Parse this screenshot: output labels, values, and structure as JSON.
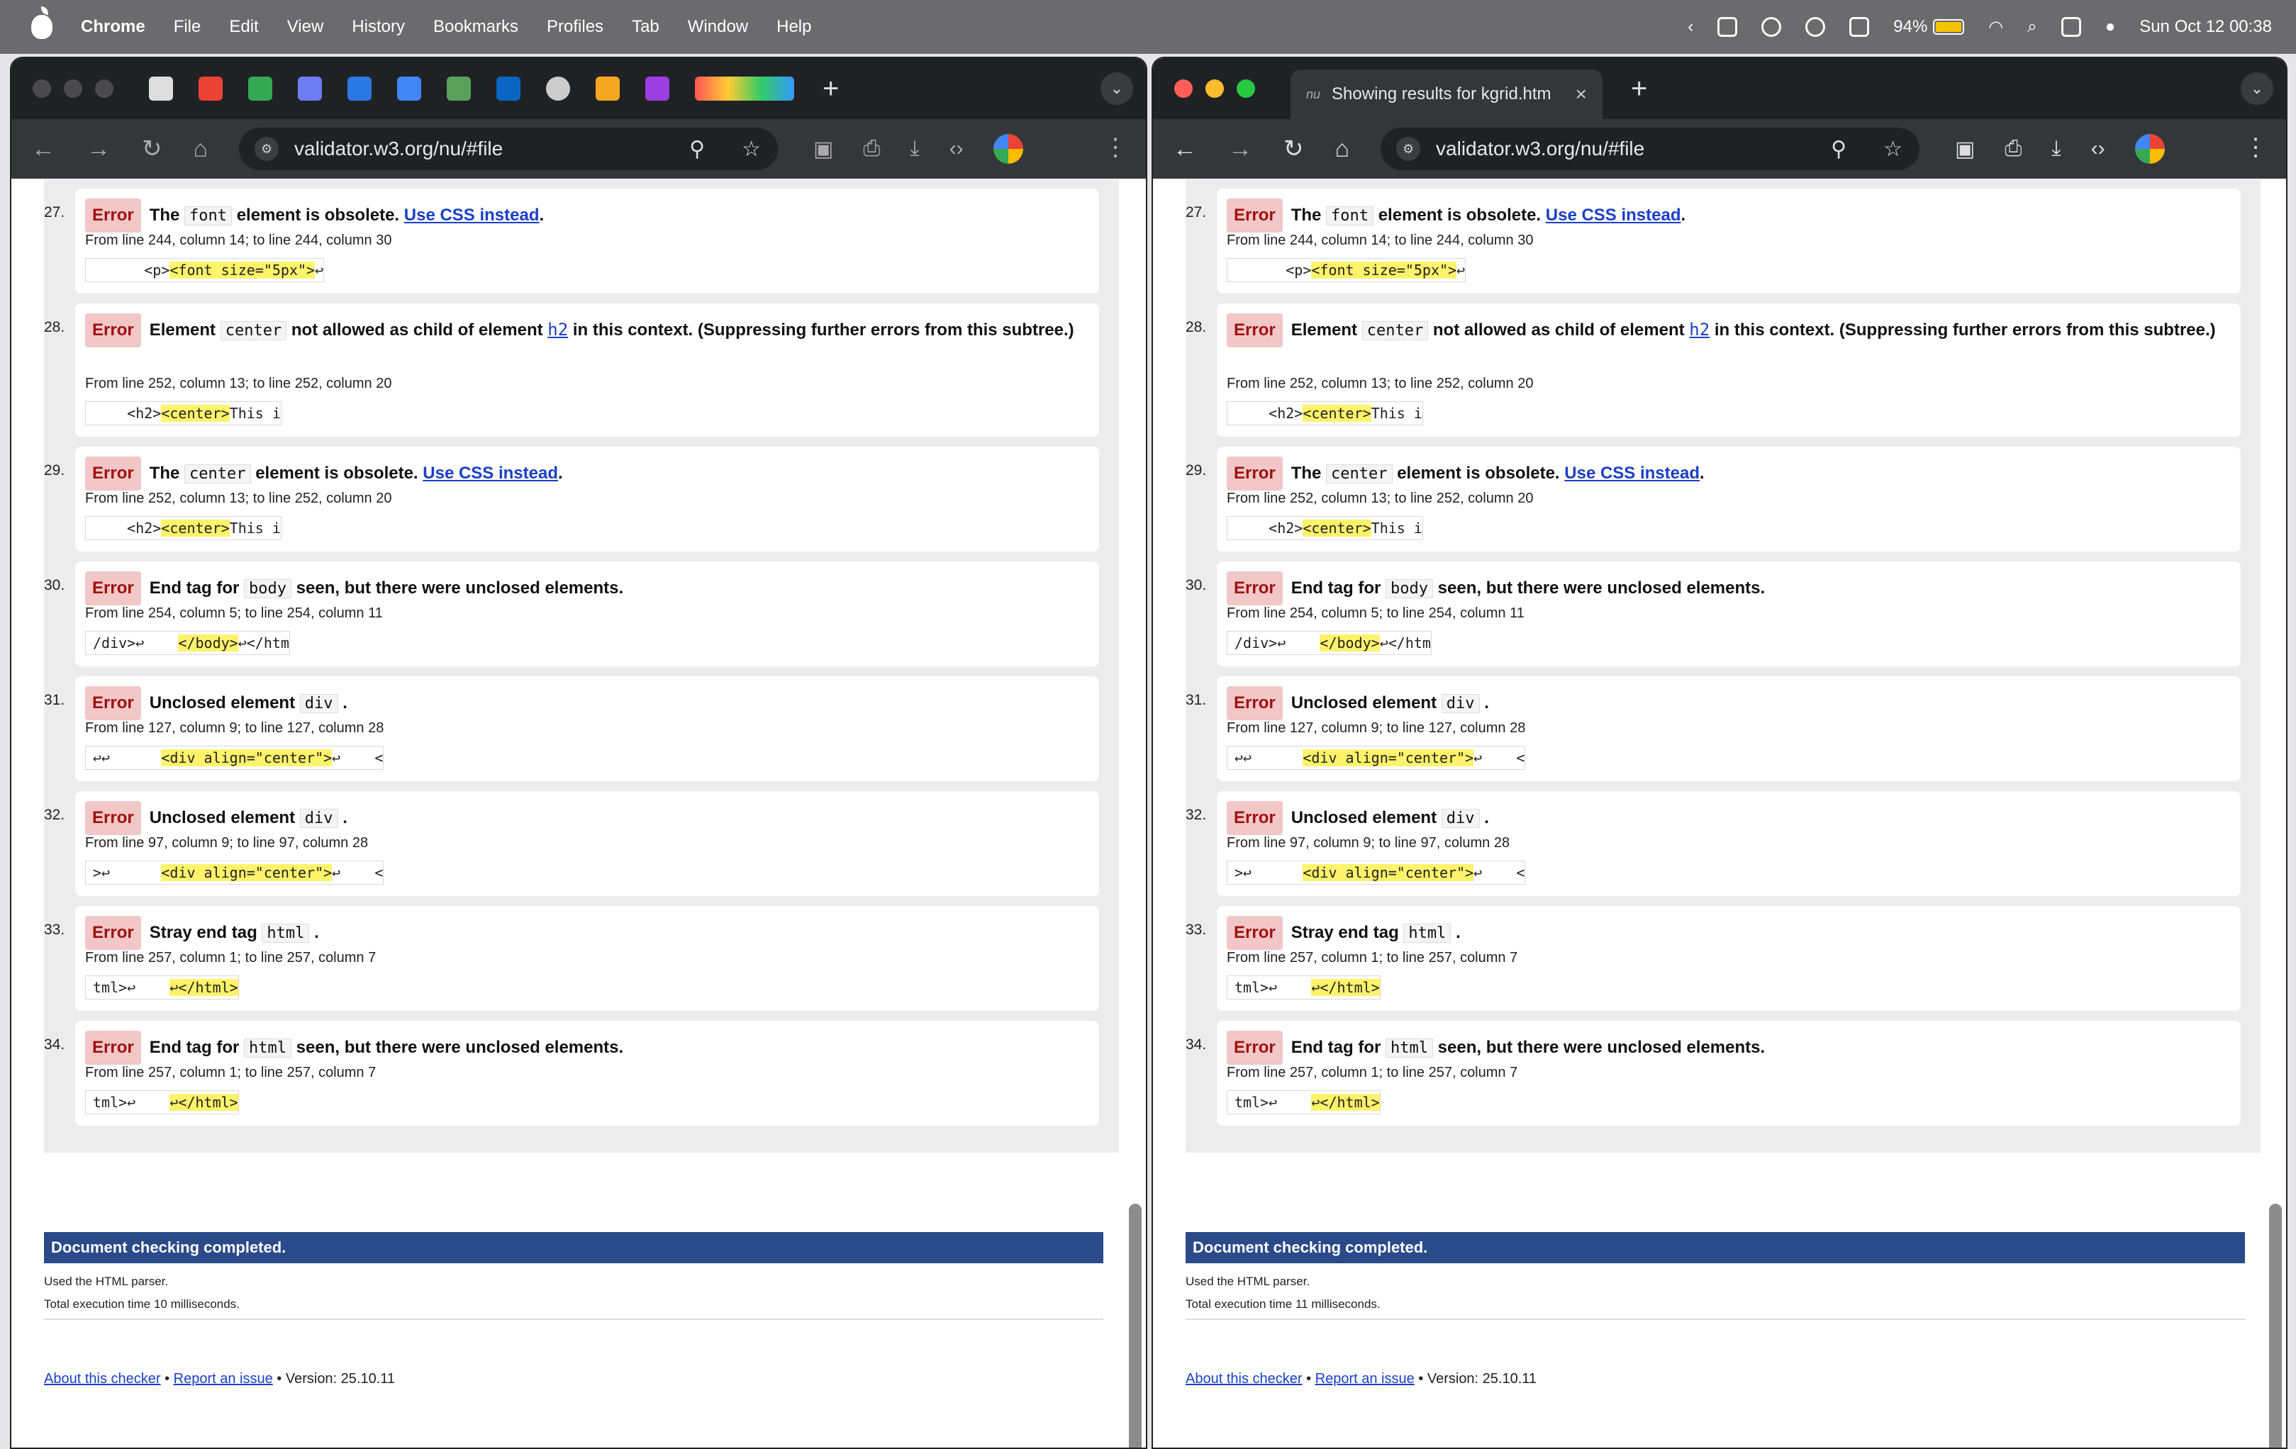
{
  "menubar": {
    "app": "Chrome",
    "items": [
      "File",
      "Edit",
      "View",
      "History",
      "Bookmarks",
      "Profiles",
      "Tab",
      "Window",
      "Help"
    ],
    "battery": "94%",
    "battery_level": 0.94,
    "clock": "Sun Oct 12  00:38"
  },
  "left_window": {
    "url": "validator.w3.org/nu/#file",
    "exec_time": "Total execution time 10 milliseconds."
  },
  "right_window": {
    "tab_title": "Showing results for kgrid.htm",
    "url": "validator.w3.org/nu/#file",
    "exec_time": "Total execution time 11 milliseconds."
  },
  "messages": [
    {
      "n": "27.",
      "badge": "Error",
      "pre": "The",
      "c1": "font",
      "mid": "element is obsolete.",
      "link": "Use CSS instead",
      "tail": ".",
      "loc": "From line 244, column 14; to line 244, column 30",
      "ex_pre": "      <p>",
      "ex_hl": "<font size=\"5px\">",
      "ex_post": "↩"
    },
    {
      "n": "28.",
      "badge": "Error",
      "pre": "Element",
      "c1": "center",
      "mid": "not allowed as child of element",
      "link": "h2",
      "tail": "in this context. (Suppressing further errors from this subtree.)",
      "loc": "From line 252, column 13; to line 252, column 20",
      "ex_pre": "    <h2>",
      "ex_hl": "<center>",
      "ex_post": "This i"
    },
    {
      "n": "29.",
      "badge": "Error",
      "pre": "The",
      "c1": "center",
      "mid": "element is obsolete.",
      "link": "Use CSS instead",
      "tail": ".",
      "loc": "From line 252, column 13; to line 252, column 20",
      "ex_pre": "    <h2>",
      "ex_hl": "<center>",
      "ex_post": "This i"
    },
    {
      "n": "30.",
      "badge": "Error",
      "pre": "End tag for",
      "c1": "body",
      "mid": "seen, but there were unclosed elements.",
      "link": "",
      "tail": "",
      "loc": "From line 254, column 5; to line 254, column 11",
      "ex_pre": "/div>↩    ",
      "ex_hl": "</body>",
      "ex_post": "↩</htm"
    },
    {
      "n": "31.",
      "badge": "Error",
      "pre": "Unclosed element",
      "c1": "div",
      "mid": ".",
      "link": "",
      "tail": "",
      "loc": "From line 127, column 9; to line 127, column 28",
      "ex_pre": "↩↩      ",
      "ex_hl": "<div align=\"center\">",
      "ex_post": "↩    <"
    },
    {
      "n": "32.",
      "badge": "Error",
      "pre": "Unclosed element",
      "c1": "div",
      "mid": ".",
      "link": "",
      "tail": "",
      "loc": "From line 97, column 9; to line 97, column 28",
      "ex_pre": ">↩      ",
      "ex_hl": "<div align=\"center\">",
      "ex_post": "↩    <"
    },
    {
      "n": "33.",
      "badge": "Error",
      "pre": "Stray end tag",
      "c1": "html",
      "mid": ".",
      "link": "",
      "tail": "",
      "loc": "From line 257, column 1; to line 257, column 7",
      "ex_pre": "tml>↩    ",
      "ex_hl": "↩</html>",
      "ex_post": ""
    },
    {
      "n": "34.",
      "badge": "Error",
      "pre": "End tag for",
      "c1": "html",
      "mid": "seen, but there were unclosed elements.",
      "link": "",
      "tail": "",
      "loc": "From line 257, column 1; to line 257, column 7",
      "ex_pre": "tml>↩    ",
      "ex_hl": "↩</html>",
      "ex_post": ""
    }
  ],
  "summary": {
    "done": "Document checking completed.",
    "parser": "Used the HTML parser."
  },
  "footer": {
    "about": "About this checker",
    "sep1": " • ",
    "report": "Report an issue",
    "version": " • Version: 25.10.11"
  }
}
